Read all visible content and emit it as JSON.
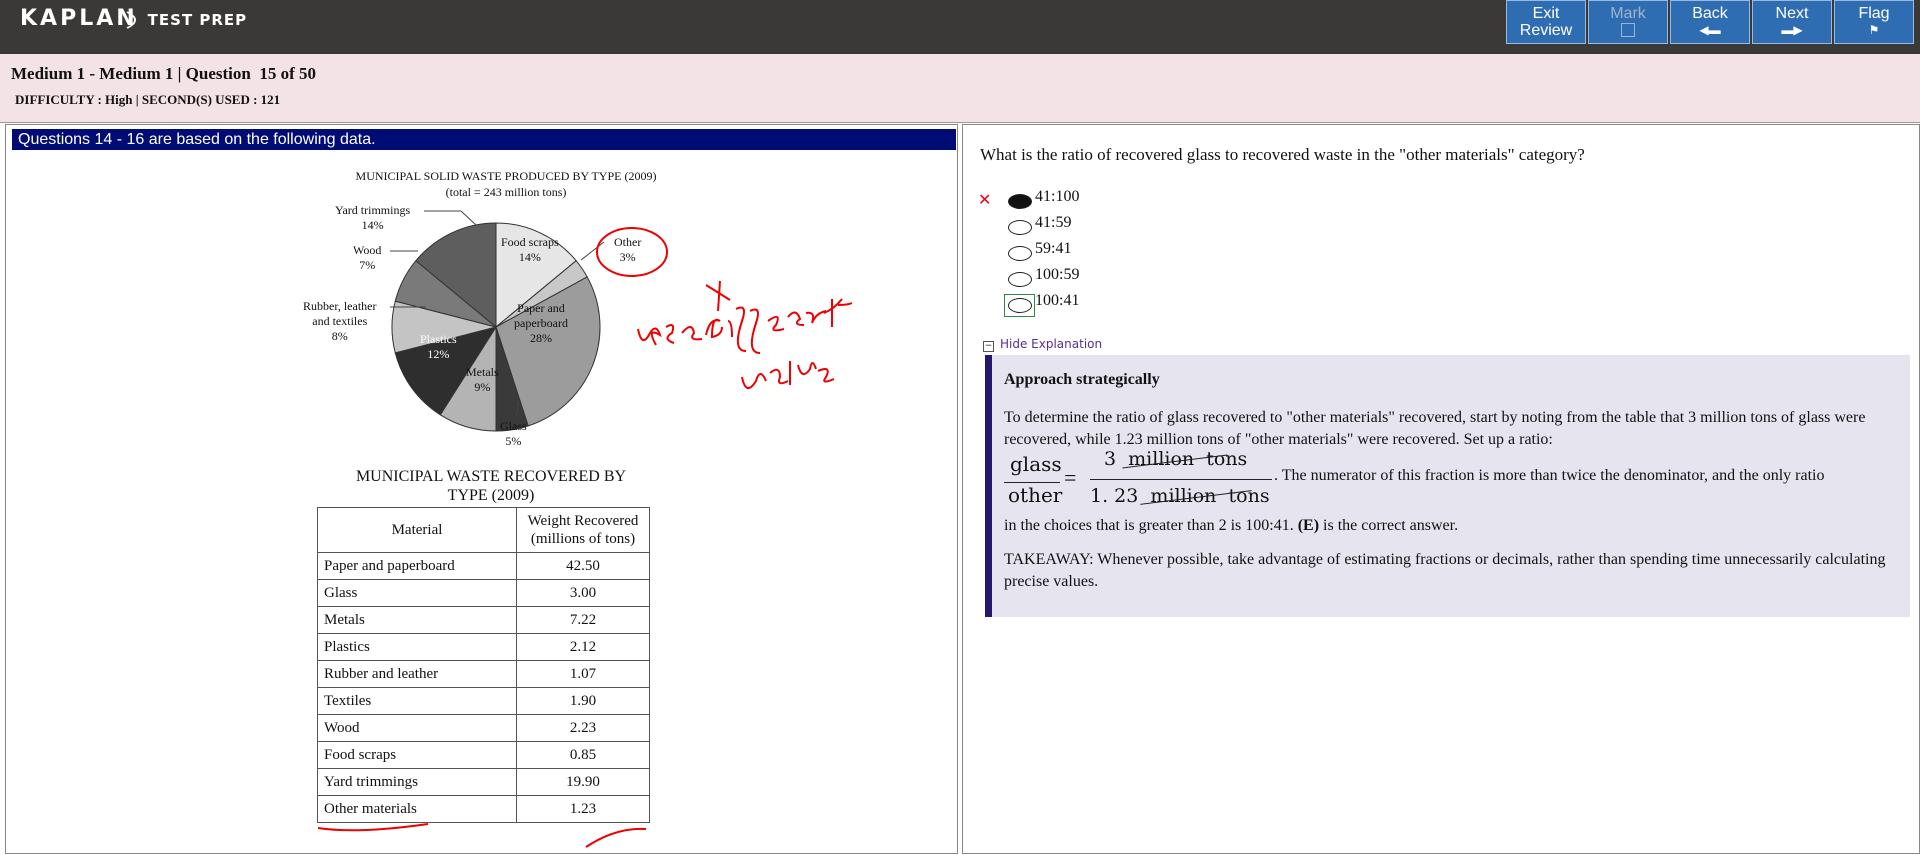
{
  "header": {
    "logo_main": "KAPLAN",
    "logo_sub": "TEST PREP",
    "buttons": {
      "exit_review": "Exit Review",
      "mark": "Mark",
      "back": "Back",
      "next": "Next",
      "flag": "Flag"
    }
  },
  "info": {
    "title": "Medium 1 - Medium 1 | Question  15 of 50",
    "difficulty": "DIFFICULTY : High | SECOND(S) USED : 121"
  },
  "passage": {
    "header": "Questions 14 - 16 are based on the following data.",
    "pie_title": "MUNICIPAL SOLID WASTE PRODUCED BY TYPE (2009)",
    "pie_subtitle": "(total = 243 million tons)",
    "pie_labels": {
      "yard": "Yard trimmings\n14%",
      "wood": "Wood\n7%",
      "rubber": "Rubber, leather\nand textiles\n8%",
      "plastics": "Plastics\n12%",
      "metals": "Metals\n9%",
      "glass": "Glass\n5%",
      "food": "Food scraps\n14%",
      "other": "Other\n3%",
      "paper": "Paper and\npaperboard\n28%"
    },
    "table_title": "MUNICIPAL WASTE RECOVERED BY TYPE (2009)",
    "table_headers": [
      "Material",
      "Weight Recovered (millions of tons)"
    ],
    "table_rows": [
      {
        "material": "Paper and paperboard",
        "value": "42.50"
      },
      {
        "material": "Glass",
        "value": "3.00"
      },
      {
        "material": "Metals",
        "value": "7.22"
      },
      {
        "material": "Plastics",
        "value": "2.12"
      },
      {
        "material": "Rubber and leather",
        "value": "1.07"
      },
      {
        "material": "Textiles",
        "value": "1.90"
      },
      {
        "material": "Wood",
        "value": "2.23"
      },
      {
        "material": "Food scraps",
        "value": "0.85"
      },
      {
        "material": "Yard trimmings",
        "value": "19.90"
      },
      {
        "material": "Other materials",
        "value": "1.23"
      }
    ]
  },
  "chart_data": {
    "type": "pie",
    "title": "MUNICIPAL SOLID WASTE PRODUCED BY TYPE (2009)",
    "subtitle": "(total = 243 million tons)",
    "categories": [
      "Food scraps",
      "Other",
      "Paper and paperboard",
      "Glass",
      "Metals",
      "Plastics",
      "Rubber, leather and textiles",
      "Wood",
      "Yard trimmings"
    ],
    "values": [
      14,
      3,
      28,
      5,
      9,
      12,
      8,
      7,
      14
    ],
    "colors": [
      "#e6e6e6",
      "#c8c8c8",
      "#9c9c9c",
      "#3a3a3a",
      "#b4b4b4",
      "#2e2e2e",
      "#c4c4c4",
      "#7a7a7a",
      "#5e5e5e"
    ]
  },
  "question": {
    "text": "What is the ratio of recovered glass to recovered waste in the \"other materials\" category?",
    "wrong_mark": "✕",
    "choices": [
      "41:100",
      "41:59",
      "59:41",
      "100:59",
      "100:41"
    ],
    "selected_index": 0,
    "correct_index": 4
  },
  "explanation": {
    "toggle_label": "Hide Explanation",
    "heading": "Approach strategically",
    "para1": "To determine the ratio of glass recovered to \"other materials\" recovered, start by noting from the table that 3 million tons of glass were recovered, while 1.23 million tons of \"other materials\" were recovered. Set up a ratio:",
    "frac_left_num": "glass",
    "frac_left_den": "other",
    "frac_eq": "=",
    "frac_right_num": "3  million  tons",
    "frac_right_den": "1. 23  million  tons",
    "after_frac": ". The numerator of this fraction is more than twice the denominator, and the only ratio",
    "para2_a": "in the choices that is greater than 2 is 100:41. ",
    "para2_b": "(E)",
    "para2_c": " is the correct answer.",
    "takeaway": "TAKEAWAY: Whenever possible, take advantage of estimating fractions or decimals, rather than spending time unnecessarily calculating precise values."
  }
}
